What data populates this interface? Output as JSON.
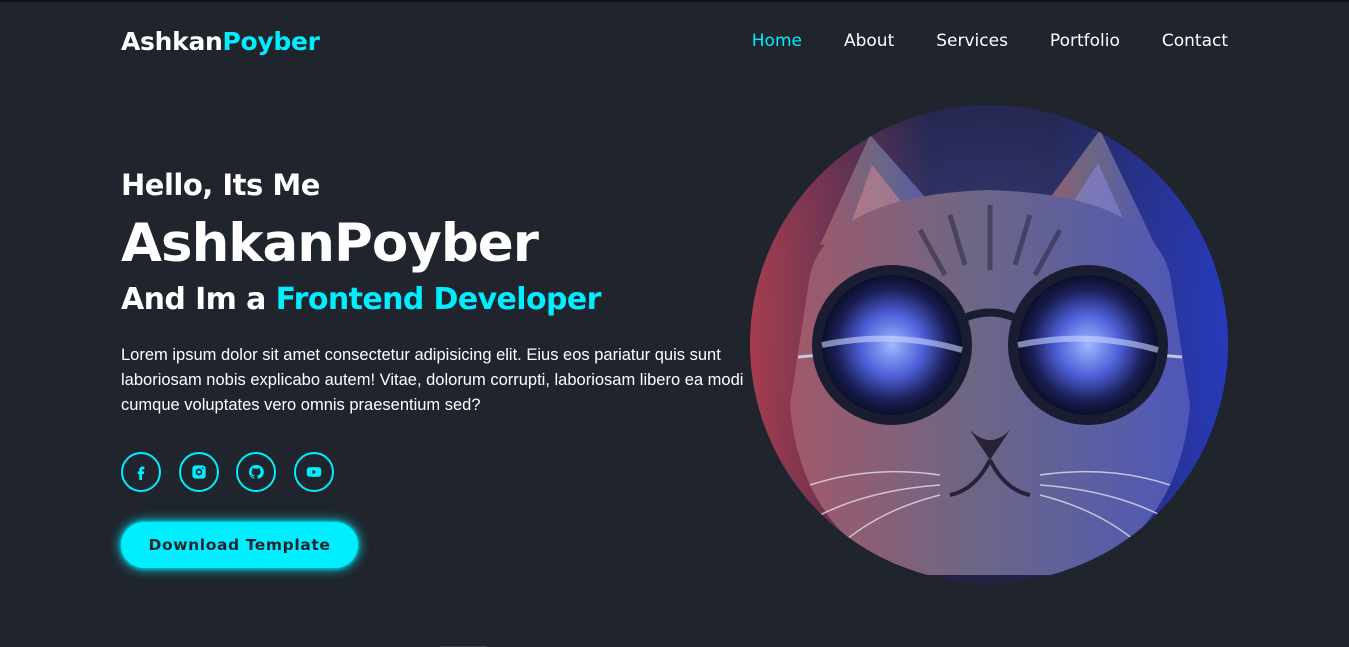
{
  "header": {
    "logo_primary": "Ashkan",
    "logo_accent": "Poyber",
    "nav": [
      {
        "label": "Home",
        "active": true
      },
      {
        "label": "About",
        "active": false
      },
      {
        "label": "Services",
        "active": false
      },
      {
        "label": "Portfolio",
        "active": false
      },
      {
        "label": "Contact",
        "active": false
      }
    ]
  },
  "hero": {
    "greeting": "Hello, Its Me",
    "name": "AshkanPoyber",
    "role_prefix": "And Im a ",
    "role_accent": "Frontend Developer",
    "description": "Lorem ipsum dolor sit amet consectetur adipisicing elit. Eius eos pariatur quis sunt laboriosam nobis explicabo autem! Vitae, dolorum corrupti, laboriosam libero ea modi cumque voluptates vero omnis praesentium sed?",
    "social_icons": [
      "facebook-icon",
      "instagram-icon",
      "github-icon",
      "youtube-icon"
    ],
    "button_label": "Download Template"
  },
  "colors": {
    "background": "#1f242d",
    "accent": "#00eeff",
    "text": "#ffffff"
  }
}
